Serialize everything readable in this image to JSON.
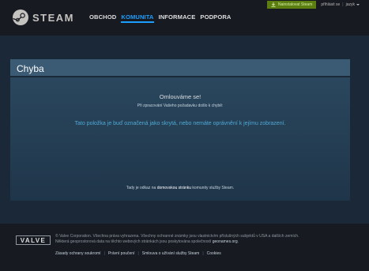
{
  "header": {
    "logo_text": "STEAM",
    "nav": [
      {
        "label": "OBCHOD",
        "active": false
      },
      {
        "label": "KOMUNITA",
        "active": true
      },
      {
        "label": "INFORMACE",
        "active": false
      },
      {
        "label": "PODPORA",
        "active": false
      }
    ],
    "install_label": "Nainstalovat Steam",
    "login_label": "přihlásit se",
    "separator": "|",
    "language_label": "jazyk"
  },
  "error": {
    "title": "Chyba",
    "heading": "Omlouváme se!",
    "subheading": "Při zpracování Vašeho požadavku došlo k chybě:",
    "message": "Tato položka je buď označená jako skrytá, nebo nemáte oprávnění k jejímu zobrazení.",
    "link_prefix": "Tady je odkaz na ",
    "link_text": "domovskou stránku",
    "link_suffix": " komunity služby Steam."
  },
  "footer": {
    "logo_text": "VALVE",
    "legal_line1": "© Valve Corporation. Všechna práva vyhrazena. Všechny ochranné známky jsou vlastnictvím příslušných subjektů v USA a dalších zemích.",
    "legal_line2": "Některá geoprostorová data na těchto webových stránkách jsou poskytována společností ",
    "legal_link": "geonames.org",
    "legal_end": ".",
    "links": [
      "Zásady ochrany soukromí",
      "Právní poučení",
      "Smlouva o užívání služby Steam",
      "Cookies"
    ],
    "link_separator": "|"
  },
  "colors": {
    "accent": "#1a9fff",
    "install_green": "#5c7e10",
    "error_blue": "#4fa9d6",
    "panel_title_bg": "#3b5a73"
  }
}
